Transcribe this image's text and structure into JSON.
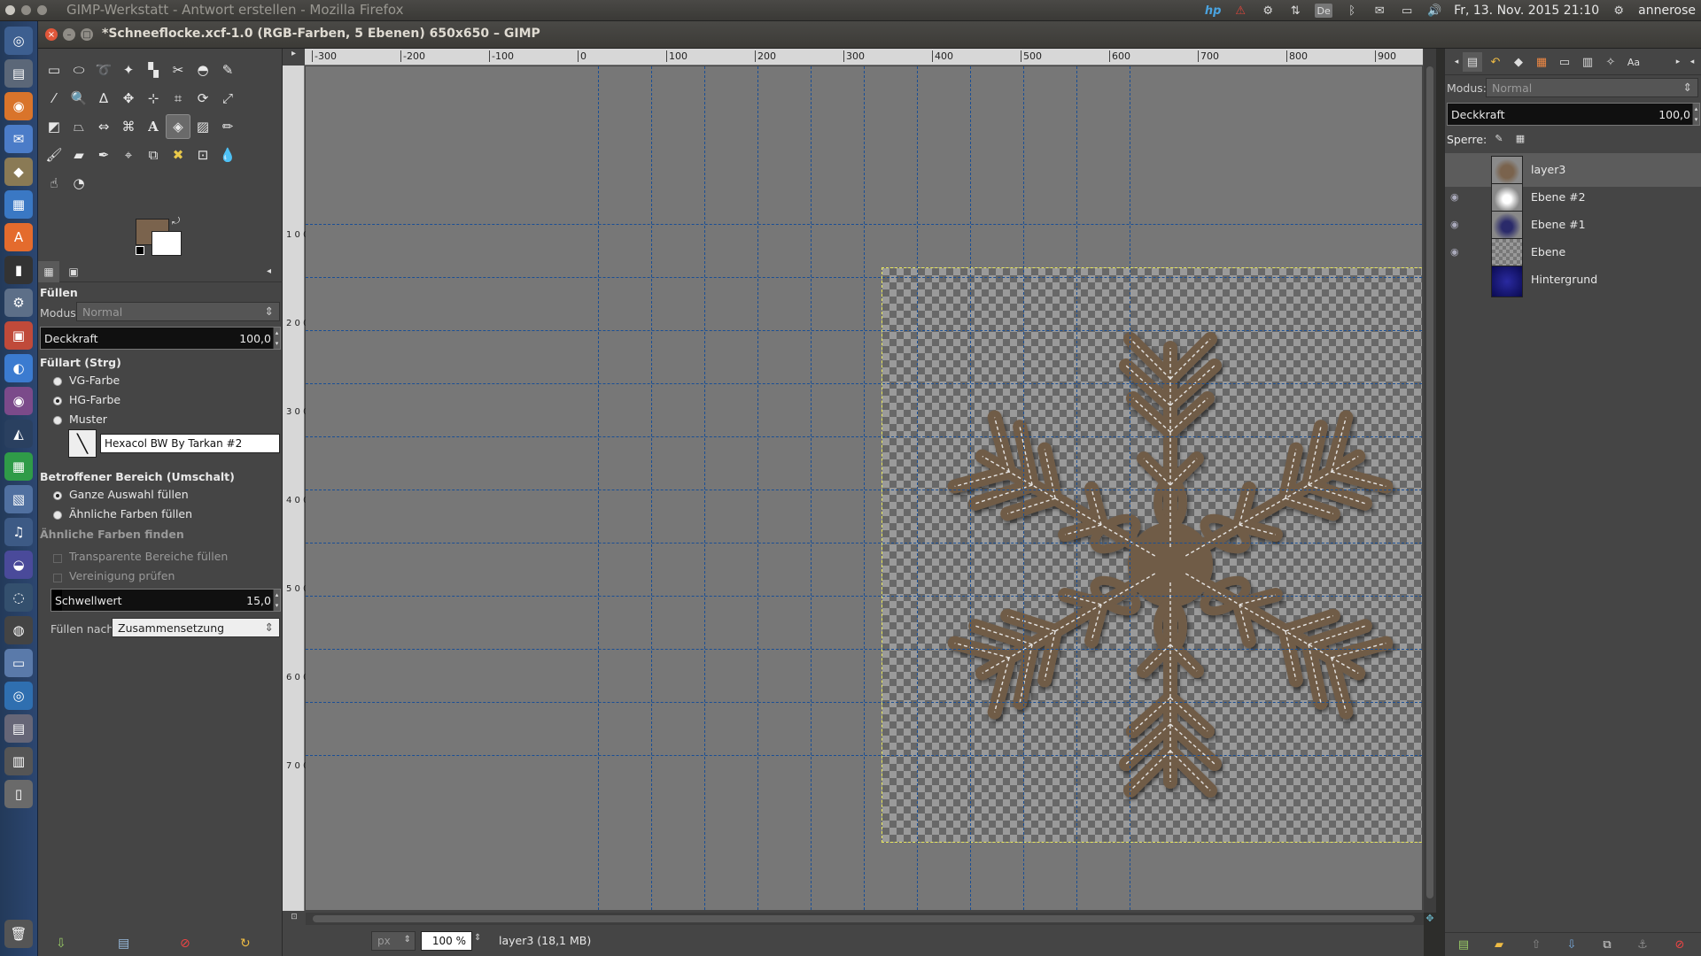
{
  "top_panel": {
    "window_title": "GIMP-Werkstatt - Antwort erstellen - Mozilla Firefox",
    "clock": "Fr, 13. Nov. 2015 21:10",
    "user": "annerose",
    "keyboard_layout": "De",
    "hp_label": "hp"
  },
  "gimp_window": {
    "title": "*Schneeflocke.xcf-1.0 (RGB-Farben, 5 Ebenen) 650x650 – GIMP"
  },
  "colors": {
    "foreground": "#7a634d",
    "background": "#ffffff",
    "accent_guides": "#1a4f95"
  },
  "tool_options": {
    "title": "Füllen",
    "mode_label": "Modus:",
    "mode_value": "Normal",
    "opacity_label": "Deckkraft",
    "opacity_value": "100,0",
    "fill_type_header": "Füllart  (Strg)",
    "fill_fg": "VG-Farbe",
    "fill_bg": "HG-Farbe",
    "fill_pattern": "Muster",
    "pattern_name": "Hexacol BW By Tarkan #2",
    "area_header": "Betroffener Bereich  (Umschalt)",
    "area_whole": "Ganze Auswahl füllen",
    "area_similar": "Ähnliche Farben füllen",
    "similar_header": "Ähnliche Farben finden",
    "transparent": "Transparente Bereiche füllen",
    "merged": "Vereinigung prüfen",
    "threshold_label": "Schwellwert",
    "threshold_value": "15,0",
    "fill_by_label": "Füllen nach:",
    "fill_by_value": "Zusammensetzung"
  },
  "hruler_labels": [
    "-300",
    "-200",
    "-100",
    "0",
    "100",
    "200",
    "300",
    "400",
    "500",
    "600",
    "700",
    "800",
    "900"
  ],
  "vruler_labels": [
    "1 0 0",
    "2 0 0",
    "3 0 0",
    "4 0 0",
    "5 0 0",
    "6 0 0",
    "7 0 0"
  ],
  "statusbar": {
    "unit": "px",
    "zoom": "100 %",
    "info": "layer3 (18,1 MB)"
  },
  "layers_dock": {
    "mode_label": "Modus:",
    "mode_value": "Normal",
    "opacity_label": "Deckkraft",
    "opacity_value": "100,0",
    "lock_label": "Sperre:",
    "layers": [
      {
        "name": "layer3",
        "visible": false,
        "selected": true
      },
      {
        "name": "Ebene #2",
        "visible": true,
        "selected": false
      },
      {
        "name": "Ebene #1",
        "visible": true,
        "selected": false
      },
      {
        "name": "Ebene",
        "visible": true,
        "selected": false
      },
      {
        "name": "Hintergrund",
        "visible": false,
        "selected": false
      }
    ]
  }
}
